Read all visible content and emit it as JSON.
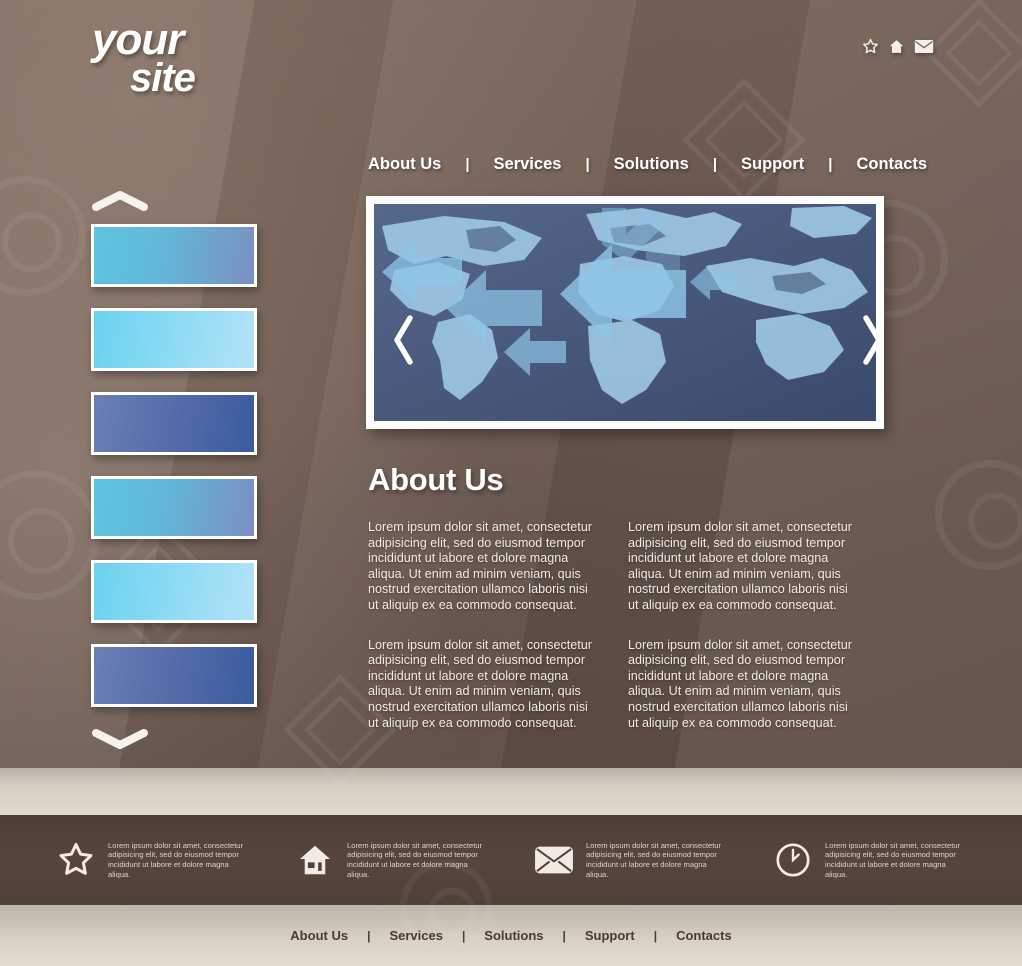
{
  "site": {
    "logo_line1": "your",
    "logo_line2": "site"
  },
  "header": {
    "icons": [
      {
        "name": "star-icon",
        "label": "Favorites"
      },
      {
        "name": "home-icon",
        "label": "Home"
      },
      {
        "name": "envelope-icon",
        "label": "Contact"
      }
    ]
  },
  "nav": {
    "separator": "|",
    "items": [
      {
        "label": "About Us"
      },
      {
        "label": "Services"
      },
      {
        "label": "Solutions"
      },
      {
        "label": "Support"
      },
      {
        "label": "Contacts"
      }
    ]
  },
  "banner": {
    "name": "world-map-slider",
    "prev_label": "‹",
    "next_label": "›",
    "bg_color": "#47567a",
    "arrow_color": "#8ec6e8",
    "land_color": "#9dc6e3"
  },
  "slider": {
    "up_label": "⌃",
    "down_label": "⌄",
    "thumbnails": [
      {
        "from": "#5cc5e0",
        "to": "#7b8fc0"
      },
      {
        "from": "#6ad2ef",
        "to": "#b3e2f7"
      },
      {
        "from": "#6a7fb5",
        "to": "#3a5ba0"
      },
      {
        "from": "#5cc5e0",
        "to": "#7b8fc0"
      },
      {
        "from": "#6ad2ef",
        "to": "#b3e2f7"
      },
      {
        "from": "#6a7fb5",
        "to": "#3a5ba0"
      }
    ]
  },
  "about": {
    "heading": "About Us",
    "paragraphs": [
      "Lorem ipsum dolor sit amet, consectetur adipisicing elit, sed do eiusmod tempor incididunt ut labore et dolore magna aliqua. Ut enim ad minim veniam, quis nostrud exercitation ullamco laboris nisi ut aliquip ex ea commodo consequat.",
      "Lorem ipsum dolor sit amet, consectetur adipisicing elit, sed do eiusmod tempor incididunt ut labore et dolore magna aliqua. Ut enim ad minim veniam, quis nostrud exercitation ullamco laboris nisi ut aliquip ex ea commodo consequat.",
      "Lorem ipsum dolor sit amet, consectetur adipisicing elit, sed do eiusmod tempor incididunt ut labore et dolore magna aliqua. Ut enim ad minim veniam, quis nostrud exercitation ullamco laboris nisi ut aliquip ex ea commodo consequat.",
      "Lorem ipsum dolor sit amet, consectetur adipisicing elit, sed do eiusmod tempor incididunt ut labore et dolore magna aliqua. Ut enim ad minim veniam, quis nostrud exercitation ullamco laboris nisi ut aliquip ex ea commodo consequat."
    ]
  },
  "features": [
    {
      "icon": "star-icon",
      "text": "Lorem ipsum dolor sit amet, consectetur adipisicing elit, sed do eiusmod tempor incididunt ut labore et dolore magna aliqua."
    },
    {
      "icon": "home-icon",
      "text": "Lorem ipsum dolor sit amet, consectetur adipisicing elit, sed do eiusmod tempor incididunt ut labore et dolore magna aliqua."
    },
    {
      "icon": "envelope-icon",
      "text": "Lorem ipsum dolor sit amet, consectetur adipisicing elit, sed do eiusmod tempor incididunt ut labore et dolore magna aliqua."
    },
    {
      "icon": "clock-icon",
      "text": "Lorem ipsum dolor sit amet, consectetur adipisicing elit, sed do eiusmod tempor incididunt ut labore et dolore magna aliqua."
    }
  ],
  "footer_nav": {
    "separator": "|",
    "items": [
      {
        "label": "About Us"
      },
      {
        "label": "Services"
      },
      {
        "label": "Solutions"
      },
      {
        "label": "Support"
      },
      {
        "label": "Contacts"
      }
    ]
  },
  "theme": {
    "hero_brown": "#6d5b51",
    "band_cream": "#e2dbcd",
    "band_dark": "#50403f",
    "band_foot": "#e4ddd0",
    "text_white": "#ffffff",
    "footer_text": "#4a3b33"
  }
}
